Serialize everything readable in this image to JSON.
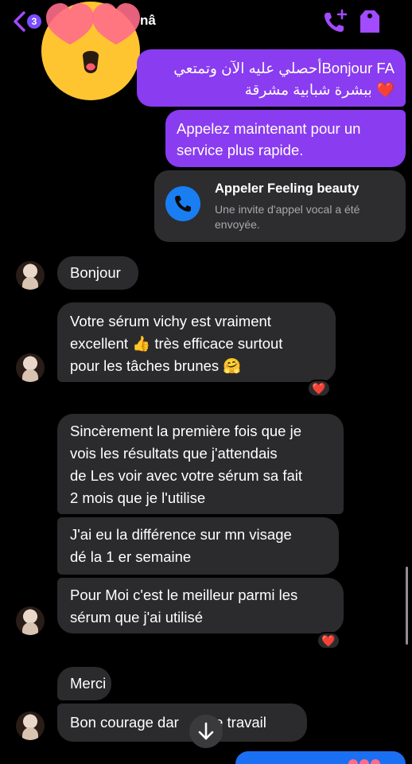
{
  "header": {
    "back_count": "3",
    "contact_name_visible": "nâ"
  },
  "messages": {
    "outgoing_1_line1": "Bonjour FAأحصلي عليه الآن وتمتعي",
    "outgoing_1_line2": "ببشرة شبابية مشرقة",
    "outgoing_1_heart": "❤️",
    "outgoing_2": "Appelez maintenant pour un service plus rapide.",
    "call_card_title": "Appeler Feeling beauty",
    "call_card_subtitle": "Une invite d'appel vocal a été envoyée.",
    "incoming_1": "Bonjour",
    "incoming_2a": "Votre sérum vichy est vraiment",
    "incoming_2b": "excellent 👍 très efficace surtout",
    "incoming_2c": "pour les tâches brunes 🤗",
    "incoming_3a": "Sincèrement la première fois que je",
    "incoming_3b": "vois les  résultats que j'attendais",
    "incoming_3c": "de Les voir avec votre sérum sa fait",
    "incoming_3d": "2 mois que je l'utilise",
    "incoming_4a": "J'ai eu la différence sur mn visage",
    "incoming_4b": "dé la 1 er semaine",
    "incoming_5a": "Pour Moi c'est le meilleur parmi les",
    "incoming_5b": "sérum que j'ai utilisé",
    "incoming_6": "Merci",
    "incoming_7_left": "Bon courage dar",
    "incoming_7_right": "tre travail"
  },
  "reactions": {
    "r1": "❤️",
    "r2": "❤️"
  },
  "colors": {
    "outgoing_bubble": "#8a3cf0",
    "incoming_bubble": "#2b2b2d",
    "accent": "#a24bff",
    "call_icon": "#1a7ef3"
  },
  "icons": {
    "back": "chevron-left-icon",
    "call": "phone-plus-icon",
    "tag": "tag-icon",
    "sticker": "heart-eyes-emoji",
    "call_card": "phone-icon",
    "scroll": "arrow-down-icon"
  }
}
